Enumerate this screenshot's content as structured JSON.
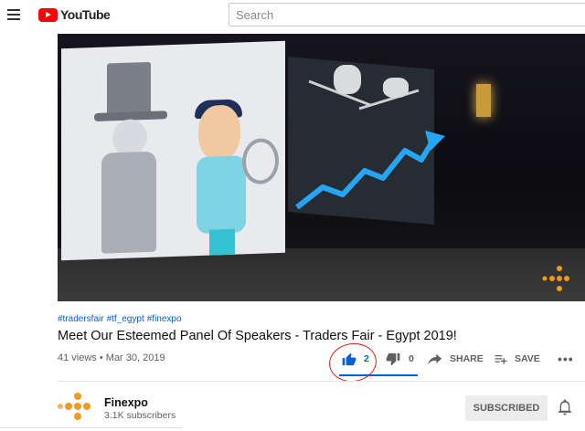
{
  "header": {
    "logo_text": "YouTube",
    "search_placeholder": "Search"
  },
  "video": {
    "hashtags": [
      "#tradersfair",
      "#tf_egypt",
      "#finexpo"
    ],
    "title": "Meet Our Esteemed Panel Of Speakers - Traders Fair - Egypt 2019!",
    "views": "41 views",
    "separator": "•",
    "date": "Mar 30, 2019"
  },
  "actions": {
    "like_count": "2",
    "dislike_count": "0",
    "share_label": "SHARE",
    "save_label": "SAVE",
    "more_label": "•••",
    "like_ratio": 1.0
  },
  "channel": {
    "name": "Finexpo",
    "subscribers": "3.1K subscribers",
    "subscribe_label": "SUBSCRIBED"
  },
  "colors": {
    "brand_red": "#ff0000",
    "link_blue": "#065fd4",
    "annotation_red": "#d32222",
    "finexpo_orange": "#f39a1e"
  }
}
